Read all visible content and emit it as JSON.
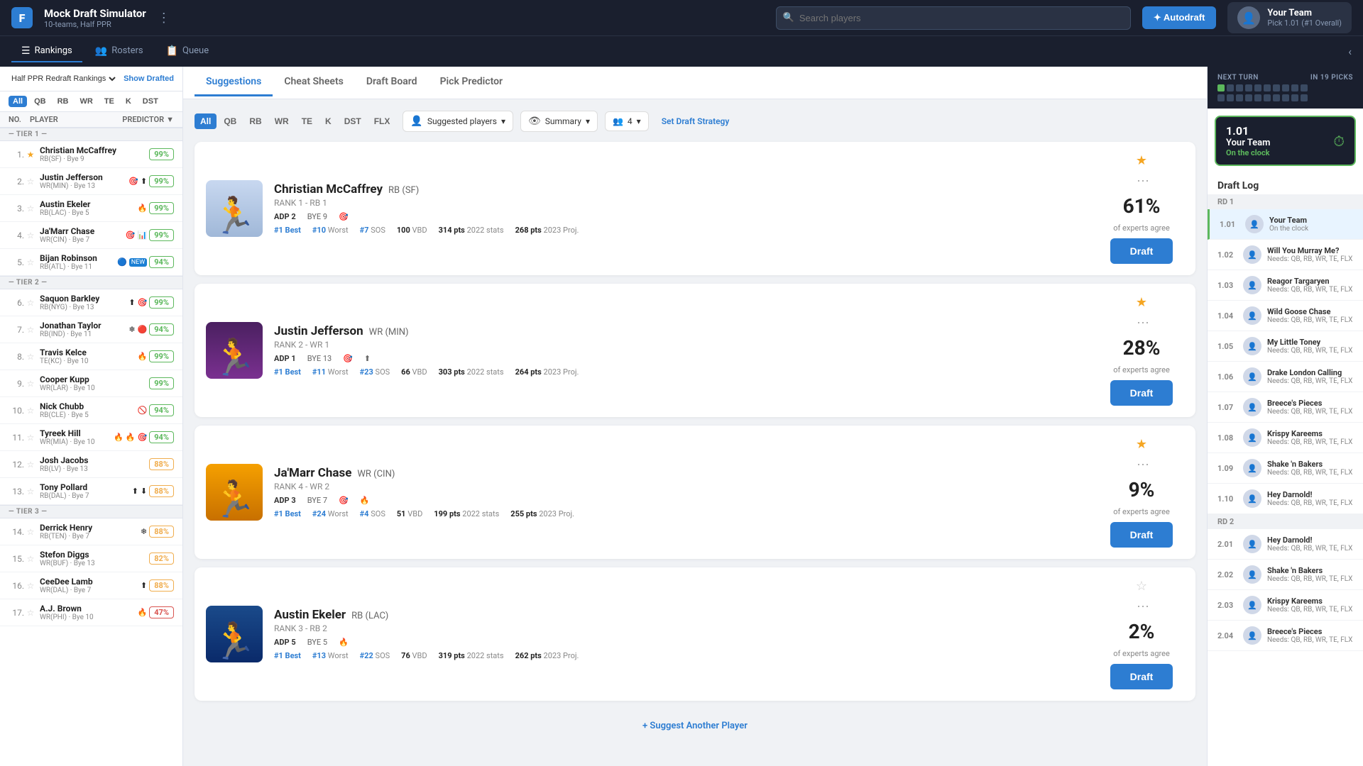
{
  "app": {
    "logo": "F",
    "title": "Mock Draft Simulator",
    "subtitle": "10-teams, Half PPR"
  },
  "header": {
    "search_placeholder": "Search players",
    "autodraft_label": "✦ Autodraft",
    "your_team": {
      "name": "Your Team",
      "pick": "Pick 1.01 (#1 Overall)"
    }
  },
  "subnav": {
    "items": [
      {
        "label": "Rankings",
        "icon": "☰",
        "active": true
      },
      {
        "label": "Rosters",
        "icon": "👥",
        "active": false
      },
      {
        "label": "Queue",
        "icon": "📋",
        "active": false
      }
    ]
  },
  "sidebar": {
    "ranking_label": "Half PPR Redraft Rankings",
    "show_drafted": "Show Drafted",
    "positions": [
      "All",
      "QB",
      "RB",
      "WR",
      "TE",
      "K",
      "DST"
    ],
    "active_pos": "All",
    "col_no": "NO.",
    "col_player": "PLAYER",
    "col_predictor": "PREDICTOR",
    "tiers": [
      {
        "label": "Tier 1",
        "players": [
          {
            "num": 1,
            "name": "Christian McCaffrey",
            "pos": "RB(SF)",
            "bye": "Bye 9",
            "score": "99%",
            "score_class": "high",
            "star": true,
            "badges": []
          },
          {
            "num": 2,
            "name": "Justin Jefferson",
            "pos": "WR(MIN)",
            "bye": "Bye 13",
            "score": "99%",
            "score_class": "high",
            "star": false,
            "badges": [
              "target",
              "up"
            ]
          },
          {
            "num": 3,
            "name": "Austin Ekeler",
            "pos": "RB(LAC)",
            "bye": "Bye 5",
            "score": "99%",
            "score_class": "high",
            "star": false,
            "badges": [
              "fire"
            ]
          },
          {
            "num": 4,
            "name": "Ja'Marr Chase",
            "pos": "WR(CIN)",
            "bye": "Bye 7",
            "score": "99%",
            "score_class": "high",
            "star": false,
            "badges": [
              "target",
              "chart"
            ]
          },
          {
            "num": 5,
            "name": "Bijan Robinson",
            "pos": "RB(ATL)",
            "bye": "Bye 11",
            "score": "94%",
            "score_class": "high",
            "star": false,
            "badges": [
              "new"
            ]
          }
        ]
      },
      {
        "label": "Tier 2",
        "players": [
          {
            "num": 6,
            "name": "Saquon Barkley",
            "pos": "RB(NYG)",
            "bye": "Bye 13",
            "score": "99%",
            "score_class": "high",
            "star": false,
            "badges": [
              "up",
              "target"
            ]
          },
          {
            "num": 7,
            "name": "Jonathan Taylor",
            "pos": "RB(IND)",
            "bye": "Bye 11",
            "score": "94%",
            "score_class": "high",
            "star": false,
            "badges": [
              "snow",
              "fire"
            ]
          },
          {
            "num": 8,
            "name": "Travis Kelce",
            "pos": "TE(KC)",
            "bye": "Bye 10",
            "score": "99%",
            "score_class": "high",
            "star": false,
            "badges": [
              "fire"
            ]
          },
          {
            "num": 9,
            "name": "Cooper Kupp",
            "pos": "WR(LAR)",
            "bye": "Bye 10",
            "score": "99%",
            "score_class": "high",
            "star": false,
            "badges": []
          },
          {
            "num": 10,
            "name": "Nick Chubb",
            "pos": "RB(CLE)",
            "bye": "Bye 5",
            "score": "94%",
            "score_class": "high",
            "star": false,
            "badges": [
              "ban"
            ]
          },
          {
            "num": 11,
            "name": "Tyreek Hill",
            "pos": "WR(MIA)",
            "bye": "Bye 10",
            "score": "94%",
            "score_class": "high",
            "star": false,
            "badges": [
              "fire",
              "fire",
              "target"
            ]
          },
          {
            "num": 12,
            "name": "Josh Jacobs",
            "pos": "RB(LV)",
            "bye": "Bye 13",
            "score": "88%",
            "score_class": "med",
            "star": false,
            "badges": []
          },
          {
            "num": 13,
            "name": "Tony Pollard",
            "pos": "RB(DAL)",
            "bye": "Bye 7",
            "score": "88%",
            "score_class": "med",
            "star": false,
            "badges": [
              "up",
              "down"
            ]
          }
        ]
      },
      {
        "label": "Tier 3",
        "players": [
          {
            "num": 14,
            "name": "Derrick Henry",
            "pos": "RB(TEN)",
            "bye": "Bye 7",
            "score": "88%",
            "score_class": "med",
            "star": false,
            "badges": [
              "snow"
            ]
          },
          {
            "num": 15,
            "name": "Stefon Diggs",
            "pos": "WR(BUF)",
            "bye": "Bye 13",
            "score": "82%",
            "score_class": "med",
            "star": false,
            "badges": []
          },
          {
            "num": 16,
            "name": "CeeDee Lamb",
            "pos": "WR(DAL)",
            "bye": "Bye 7",
            "score": "88%",
            "score_class": "med",
            "star": false,
            "badges": [
              "up"
            ]
          },
          {
            "num": 17,
            "name": "A.J. Brown",
            "pos": "WR(PHI)",
            "bye": "Bye 10",
            "score": "47%",
            "score_class": "low",
            "star": false,
            "badges": [
              "fire"
            ]
          }
        ]
      }
    ]
  },
  "center": {
    "tabs": [
      {
        "label": "Suggestions",
        "active": true
      },
      {
        "label": "Cheat Sheets",
        "active": false
      },
      {
        "label": "Draft Board",
        "active": false
      },
      {
        "label": "Pick Predictor",
        "active": false
      }
    ],
    "pos_filters": [
      "All",
      "QB",
      "RB",
      "WR",
      "TE",
      "K",
      "DST",
      "FLX"
    ],
    "active_pos": "All",
    "dropdown_players": "Suggested players",
    "dropdown_summary": "Summary",
    "dropdown_count": "4",
    "set_strategy": "Set Draft Strategy",
    "suggest_another": "+ Suggest Another Player",
    "cards": [
      {
        "name": "Christian McCaffrey",
        "pos": "RB",
        "team": "SF",
        "rank_label": "RANK 1 - RB 1",
        "adp": "ADP 2",
        "bye": "BYE 9",
        "best": "#1 Best",
        "worst": "#10 Worst",
        "sos": "#7 SOS",
        "vbd": "100 VBD",
        "stats_2022": "314 pts",
        "stats_2023": "268 pts",
        "agree_pct": "61%",
        "agree_label": "of experts agree",
        "draft_btn": "Draft",
        "fav": true,
        "badges": []
      },
      {
        "name": "Justin Jefferson",
        "pos": "WR",
        "team": "MIN",
        "rank_label": "RANK 2 - WR 1",
        "adp": "ADP 1",
        "bye": "BYE 13",
        "best": "#1 Best",
        "worst": "#11 Worst",
        "sos": "#23 SOS",
        "vbd": "66 VBD",
        "stats_2022": "303 pts",
        "stats_2023": "264 pts",
        "agree_pct": "28%",
        "agree_label": "of experts agree",
        "draft_btn": "Draft",
        "fav": true,
        "badges": [
          "target",
          "up"
        ]
      },
      {
        "name": "Ja'Marr Chase",
        "pos": "WR",
        "team": "CIN",
        "rank_label": "RANK 4 - WR 2",
        "adp": "ADP 3",
        "bye": "BYE 7",
        "best": "#1 Best",
        "worst": "#24 Worst",
        "sos": "#4 SOS",
        "vbd": "51 VBD",
        "stats_2022": "199 pts",
        "stats_2023": "255 pts",
        "agree_pct": "9%",
        "agree_label": "of experts agree",
        "draft_btn": "Draft",
        "fav": true,
        "badges": [
          "target",
          "fire"
        ]
      },
      {
        "name": "Austin Ekeler",
        "pos": "RB",
        "team": "LAC",
        "rank_label": "RANK 3 - RB 2",
        "adp": "ADP 5",
        "bye": "BYE 5",
        "best": "#1 Best",
        "worst": "#13 Worst",
        "sos": "#22 SOS",
        "vbd": "76 VBD",
        "stats_2022": "319 pts",
        "stats_2023": "262 pts",
        "agree_pct": "2%",
        "agree_label": "of experts agree",
        "draft_btn": "Draft",
        "fav": false,
        "badges": [
          "fire"
        ]
      }
    ]
  },
  "right_panel": {
    "next_turn_label": "NEXT TURN",
    "in_picks": "IN 19 PICKS",
    "on_clock_pick": "1.01",
    "on_clock_team": "Your Team",
    "on_clock_label": "On the clock",
    "draft_log_title": "Draft Log",
    "rounds": [
      {
        "label": "RD 1",
        "picks": [
          {
            "num": "1.01",
            "team": "Your Team",
            "needs": "On the clock",
            "current": true
          },
          {
            "num": "1.02",
            "team": "Will You Murray Me?",
            "needs": "Needs: QB, RB, WR, TE, FLX"
          },
          {
            "num": "1.03",
            "team": "Reagor Targaryen",
            "needs": "Needs: QB, RB, WR, TE, FLX"
          },
          {
            "num": "1.04",
            "team": "Wild Goose Chase",
            "needs": "Needs: QB, RB, WR, TE, FLX"
          },
          {
            "num": "1.05",
            "team": "My Little Toney",
            "needs": "Needs: QB, RB, WR, TE, FLX"
          },
          {
            "num": "1.06",
            "team": "Drake London Calling",
            "needs": "Needs: QB, RB, WR, TE, FLX"
          },
          {
            "num": "1.07",
            "team": "Breece's Pieces",
            "needs": "Needs: QB, RB, WR, TE, FLX"
          },
          {
            "num": "1.08",
            "team": "Krispy Kareems",
            "needs": "Needs: QB, RB, WR, TE, FLX"
          },
          {
            "num": "1.09",
            "team": "Shake 'n Bakers",
            "needs": "Needs: QB, RB, WR, TE, FLX"
          },
          {
            "num": "1.10",
            "team": "Hey Darnold!",
            "needs": "Needs: QB, RB, WR, TE, FLX"
          }
        ]
      },
      {
        "label": "RD 2",
        "picks": [
          {
            "num": "2.01",
            "team": "Hey Darnold!",
            "needs": "Needs: QB, RB, WR, TE, FLX"
          },
          {
            "num": "2.02",
            "team": "Shake 'n Bakers",
            "needs": "Needs: QB, RB, WR, TE, FLX"
          },
          {
            "num": "2.03",
            "team": "Krispy Kareems",
            "needs": "Needs: QB, RB, WR, TE, FLX"
          },
          {
            "num": "2.04",
            "team": "Breece's Pieces",
            "needs": "Needs: QB, RB, WR, TE, FLX"
          }
        ]
      }
    ]
  }
}
